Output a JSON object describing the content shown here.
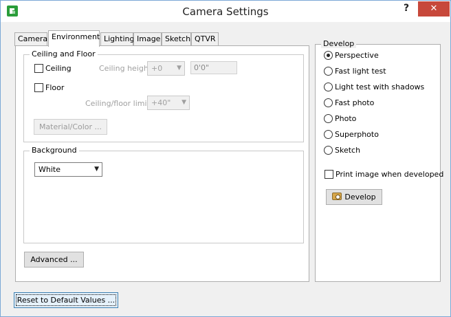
{
  "window": {
    "title": "Camera Settings",
    "help_label": "?",
    "close_label": "✕"
  },
  "tabs": [
    {
      "label": "Camera"
    },
    {
      "label": "Environment"
    },
    {
      "label": "Lighting"
    },
    {
      "label": "Image"
    },
    {
      "label": "Sketch"
    },
    {
      "label": "QTVR"
    }
  ],
  "active_tab": "Environment",
  "ceiling_floor": {
    "group_label": "Ceiling and Floor",
    "ceiling_label": "Ceiling",
    "ceiling_checked": false,
    "floor_label": "Floor",
    "floor_checked": false,
    "ceiling_height_label": "Ceiling height",
    "ceiling_height_value": "+0",
    "ceiling_height_text": "0'0\"",
    "limits_label": "Ceiling/floor limits",
    "limits_value": "+40\"",
    "material_button": "Material/Color ..."
  },
  "background": {
    "group_label": "Background",
    "value": "White"
  },
  "advanced_button": "Advanced ...",
  "reset_button": "Reset to Default Values ...",
  "develop": {
    "group_label": "Develop",
    "options": [
      {
        "label": "Perspective",
        "checked": true
      },
      {
        "label": "Fast light test",
        "checked": false
      },
      {
        "label": "Light test with shadows",
        "checked": false
      },
      {
        "label": "Fast photo",
        "checked": false
      },
      {
        "label": "Photo",
        "checked": false
      },
      {
        "label": "Superphoto",
        "checked": false
      },
      {
        "label": "Sketch",
        "checked": false
      }
    ],
    "print_label": "Print image when developed",
    "print_checked": false,
    "develop_button": "Develop"
  },
  "colors": {
    "close_red": "#c7483b",
    "accent_blue": "#3c7fb1",
    "icon_green": "#2a9d3a"
  }
}
